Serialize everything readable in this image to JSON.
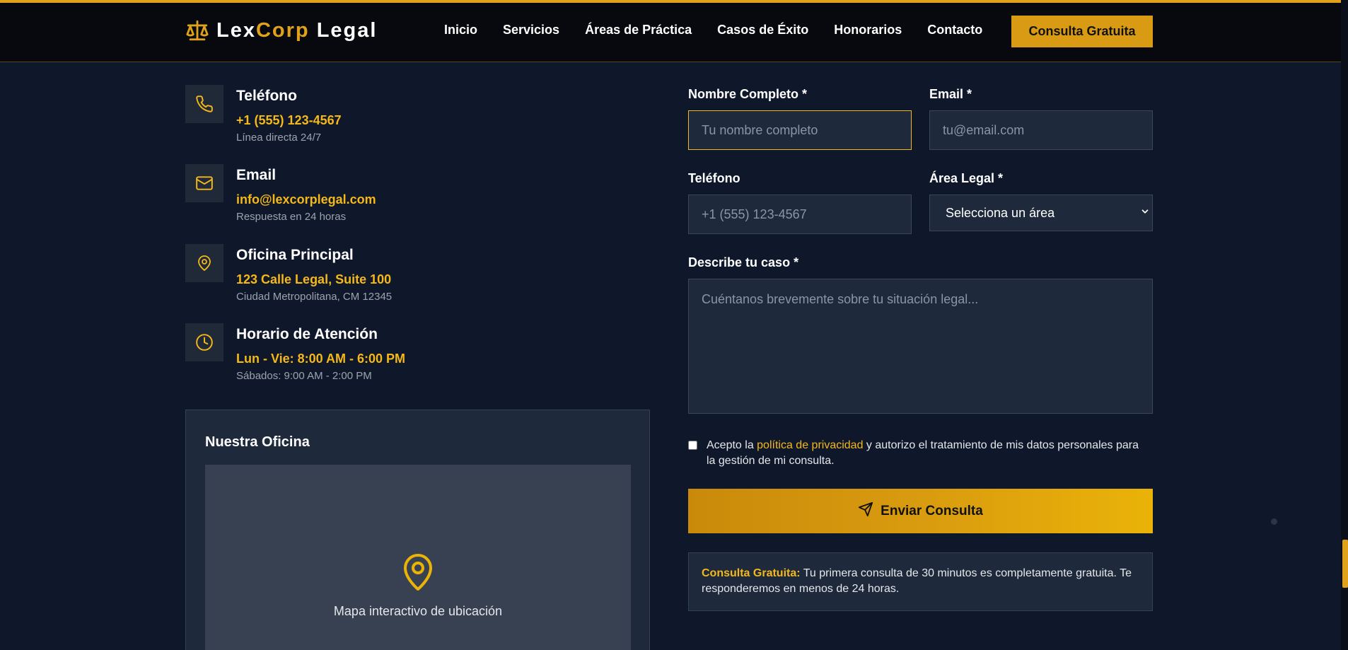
{
  "brand": {
    "part1": "Lex",
    "part2": "Corp",
    "part3": " Legal"
  },
  "nav": {
    "links": [
      "Inicio",
      "Servicios",
      "Áreas de Práctica",
      "Casos de Éxito",
      "Honorarios",
      "Contacto"
    ],
    "cta": "Consulta Gratuita"
  },
  "contact": {
    "items": [
      {
        "title": "Teléfono",
        "value": "+1 (555) 123-4567",
        "note": "Línea directa 24/7",
        "icon": "phone-icon"
      },
      {
        "title": "Email",
        "value": "info@lexcorplegal.com",
        "note": "Respuesta en 24 horas",
        "icon": "mail-icon"
      },
      {
        "title": "Oficina Principal",
        "value": "123 Calle Legal, Suite 100",
        "note": "Ciudad Metropolitana, CM 12345",
        "icon": "map-pin-icon"
      },
      {
        "title": "Horario de Atención",
        "value": "Lun - Vie: 8:00 AM - 6:00 PM",
        "note": "Sábados: 9:00 AM - 2:00 PM",
        "icon": "clock-icon"
      }
    ],
    "office": {
      "title": "Nuestra Oficina",
      "map_label": "Mapa interactivo de ubicación"
    }
  },
  "form": {
    "name": {
      "label": "Nombre Completo *",
      "placeholder": "Tu nombre completo",
      "value": ""
    },
    "email": {
      "label": "Email *",
      "placeholder": "tu@email.com",
      "value": ""
    },
    "phone": {
      "label": "Teléfono",
      "placeholder": "+1 (555) 123-4567",
      "value": ""
    },
    "area": {
      "label": "Área Legal *",
      "selected": "Selecciona un área"
    },
    "case": {
      "label": "Describe tu caso *",
      "placeholder": "Cuéntanos brevemente sobre tu situación legal...",
      "value": ""
    },
    "consent": {
      "before": "Acepto la ",
      "link": "política de privacidad",
      "after": " y autorizo el tratamiento de mis datos personales para la gestión de mi consulta.",
      "checked": false
    },
    "submit": "Enviar Consulta",
    "notice": {
      "strong": "Consulta Gratuita:",
      "text": " Tu primera consulta de 30 minutos es completamente gratuita. Te responderemos en menos de 24 horas."
    }
  },
  "colors": {
    "accent": "#e0a21a",
    "background": "#0f172a",
    "card": "#1e293b"
  }
}
